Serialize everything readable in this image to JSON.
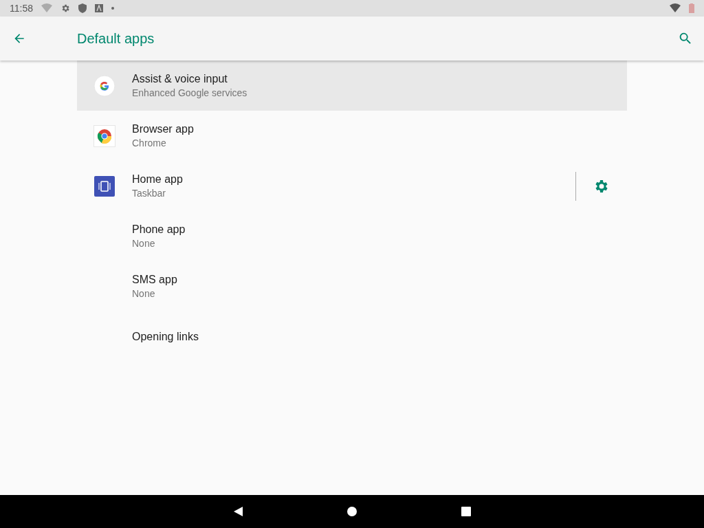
{
  "status_bar": {
    "time": "11:58"
  },
  "toolbar": {
    "title": "Default apps"
  },
  "items": [
    {
      "title": "Assist & voice input",
      "summary": "Enhanced Google services",
      "kind": "google",
      "selected": true,
      "has_settings": false
    },
    {
      "title": "Browser app",
      "summary": "Chrome",
      "kind": "chrome",
      "selected": false,
      "has_settings": false
    },
    {
      "title": "Home app",
      "summary": "Taskbar",
      "kind": "launcher",
      "selected": false,
      "has_settings": true
    },
    {
      "title": "Phone app",
      "summary": "None",
      "kind": "plain",
      "selected": false,
      "has_settings": false
    },
    {
      "title": "SMS app",
      "summary": "None",
      "kind": "plain",
      "selected": false,
      "has_settings": false
    },
    {
      "title": "Opening links",
      "kind": "plain",
      "selected": false,
      "has_settings": false
    }
  ]
}
